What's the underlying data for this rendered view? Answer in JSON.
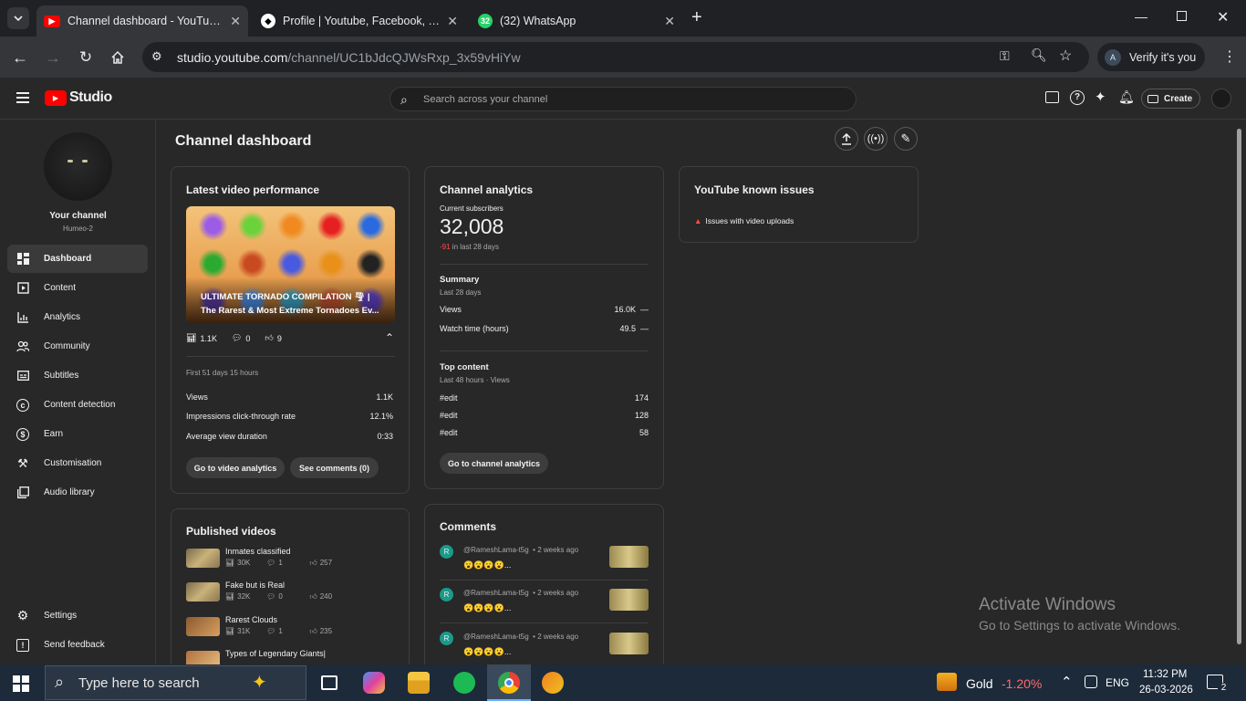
{
  "browser": {
    "tabs": [
      {
        "title": "Channel dashboard - YouTube Studio",
        "active": true
      },
      {
        "title": "Profile | Youtube, Facebook, Twitter",
        "active": false
      },
      {
        "title": "(32) WhatsApp",
        "badge": "32",
        "active": false
      }
    ],
    "url_domain": "studio.youtube.com",
    "url_path": "/channel/UC1bJdcQJWsRxp_3x59vHiYw",
    "verify_label": "Verify it's you",
    "verify_avatar": "A"
  },
  "studio": {
    "logo_text": "Studio",
    "search_placeholder": "Search across your channel",
    "create_label": "Create"
  },
  "sidebar": {
    "channel_label": "Your channel",
    "channel_name": "Humeo-2",
    "items": [
      {
        "label": "Dashboard",
        "icon": "dashboard-icon",
        "selected": true
      },
      {
        "label": "Content",
        "icon": "content-icon"
      },
      {
        "label": "Analytics",
        "icon": "analytics-icon"
      },
      {
        "label": "Community",
        "icon": "community-icon"
      },
      {
        "label": "Subtitles",
        "icon": "subtitles-icon"
      },
      {
        "label": "Content detection",
        "icon": "copyright-icon"
      },
      {
        "label": "Earn",
        "icon": "dollar-icon"
      },
      {
        "label": "Customisation",
        "icon": "wand-icon"
      },
      {
        "label": "Audio library",
        "icon": "audio-library-icon"
      }
    ],
    "settings": "Settings",
    "feedback": "Send feedback"
  },
  "page_title": "Channel dashboard",
  "latest": {
    "title": "Latest video performance",
    "video_title_line1": "ULTIMATE TORNADO COMPILATION 🌪 |",
    "video_title_line2": "The Rarest & Most Extreme Tornadoes Ev...",
    "views_count": "1.1K",
    "comments_count": "0",
    "likes_count": "9",
    "period": "First 51 days 15 hours",
    "rows": [
      {
        "label": "Views",
        "value": "1.1K"
      },
      {
        "label": "Impressions click-through rate",
        "value": "12.1%"
      },
      {
        "label": "Average view duration",
        "value": "0:33"
      }
    ],
    "btn_analytics": "Go to video analytics",
    "btn_comments": "See comments (0)"
  },
  "analytics": {
    "title": "Channel analytics",
    "subs_label": "Current subscribers",
    "subs_value": "32,008",
    "subs_change": "-91",
    "subs_change_suffix": "in last 28 days",
    "summary_title": "Summary",
    "summary_period": "Last 28 days",
    "summary_rows": [
      {
        "label": "Views",
        "value": "16.0K",
        "trend": "—"
      },
      {
        "label": "Watch time (hours)",
        "value": "49.5",
        "trend": "—"
      }
    ],
    "top_title": "Top content",
    "top_period": "Last 48 hours · Views",
    "top_rows": [
      {
        "label": "#edit",
        "value": "174"
      },
      {
        "label": "#edit",
        "value": "128"
      },
      {
        "label": "#edit",
        "value": "58"
      }
    ],
    "btn": "Go to channel analytics"
  },
  "known": {
    "title": "YouTube known issues",
    "issue": "Issues with video uploads"
  },
  "published": {
    "title": "Published videos",
    "videos": [
      {
        "title": "Inmates classified",
        "views": "30K",
        "comments": "1",
        "likes": "257"
      },
      {
        "title": "Fake but is Real",
        "views": "32K",
        "comments": "0",
        "likes": "240"
      },
      {
        "title": "Rarest Clouds",
        "views": "31K",
        "comments": "1",
        "likes": "235"
      },
      {
        "title": "Types of Legendary Giants|",
        "views": "",
        "comments": "",
        "likes": ""
      }
    ]
  },
  "comments": {
    "title": "Comments",
    "items": [
      {
        "author": "@RameshLama-t5g",
        "time": "• 2 weeks ago",
        "text": "😮😮😮😮...",
        "avatar": "R"
      },
      {
        "author": "@RameshLama-t5g",
        "time": "• 2 weeks ago",
        "text": "😮😮😮😮...",
        "avatar": "R"
      },
      {
        "author": "@RameshLama-t5g",
        "time": "• 2 weeks ago",
        "text": "😮😮😮😮...",
        "avatar": "R"
      }
    ]
  },
  "watermark": {
    "line1": "Activate Windows",
    "line2": "Go to Settings to activate Windows."
  },
  "taskbar": {
    "search": "Type here to search",
    "ticker_name": "Gold",
    "ticker_change": "-1.20%",
    "lang": "ENG",
    "time": "11:32 PM",
    "date": "26-03-2026",
    "notif": "2"
  },
  "colors": {
    "accent_red": "#ff0000",
    "negative": "#ff4e45",
    "taskbar": "#1c2a3a"
  }
}
